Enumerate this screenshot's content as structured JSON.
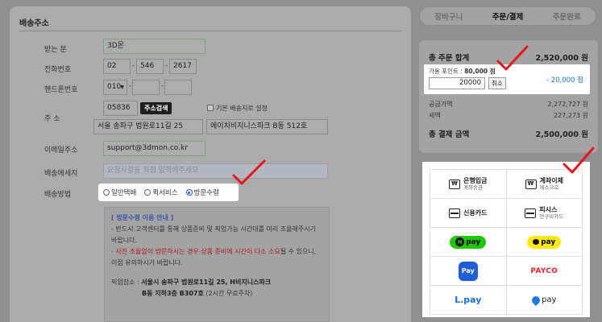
{
  "shipping": {
    "title": "배송주소",
    "fields": {
      "name_label": "받는 분",
      "name_value": "3D몬",
      "phone_label": "전화번호",
      "phone": [
        "02",
        "546",
        "2617"
      ],
      "mobile_label": "핸드폰번호",
      "mobile_prefix": "010",
      "address_label": "주 소",
      "zipcode": "05836",
      "address_search_btn": "주소검색",
      "default_address_label": "기본 배송지로 설정",
      "address1": "서울 송파구 법원로11길 25",
      "address2": "에이치비지니스파크 B동 512호",
      "email_label": "이메일주소",
      "email_value": "support@3dmon.co.kr",
      "message_label": "배송메세지",
      "message_placeholder": "요청사항을 직접 입력해주세요",
      "method_label": "배송방법"
    },
    "methods": [
      "일반택배",
      "퀵서비스",
      "방문수령"
    ],
    "selected_method": "방문수령",
    "notice": {
      "title": "[ 방문수령 이용 안내 ]",
      "line1": "- 반드시 고객센터를 통해 상품준비 및 픽업가능 시간대를 미리 조율해주시기 바랍니다.",
      "line2_red": "- 사전 조율없이 방문하시는 경우 상품 준비에 시간이 다소 소요",
      "line2_rest": "될 수 있으니,",
      "line3": "이점 유의하시기 바랍니다.",
      "pickup_label": "픽업장소 :",
      "pickup_addr1": "서울시 송파구 법원로11길 25, H비지니스파크",
      "pickup_addr2": "B동 지하3층 B307호",
      "pickup_note": "(2시간 무료주차)"
    }
  },
  "steps": [
    "장바구니",
    "주문/결제",
    "주문완료"
  ],
  "current_step": "주문/결제",
  "summary": {
    "total_label": "총 주문 합계",
    "total_value": "2,520,000 원",
    "points_label": "가용 포인트 :",
    "points_value": "80,000 점",
    "points_input": "20000",
    "points_cancel": "취소",
    "points_discount": "- 20,000 점",
    "supply_label": "공급가액",
    "supply_value": "2,272,727 원",
    "tax_label": "세액",
    "tax_value": "227,273 원",
    "final_label": "총 결제 금액",
    "final_value": "2,500,000 원"
  },
  "payment": {
    "bank_main": "은행입금",
    "bank_sub": "계좌송금",
    "transfer_main": "계좌이체",
    "transfer_sub": "에스크로",
    "card": "신용카드",
    "pcash_main": "피시스",
    "pcash_sub": "연구비카드",
    "npay": "pay",
    "kpay": "pay",
    "apple": "Pay",
    "payco": "PAYCO",
    "lpay": "L.pay",
    "toss": "pay"
  },
  "colors": {
    "check": "#e8141c",
    "radio": "#1a58d6",
    "payco": "#e5262f"
  }
}
